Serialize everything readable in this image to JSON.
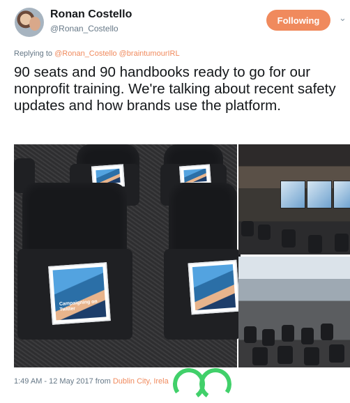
{
  "author": {
    "name": "Ronan Costello",
    "handle": "@Ronan_Costello"
  },
  "follow_button": {
    "label": "Following"
  },
  "menu_icon": "chevron-down-icon",
  "reply": {
    "prefix": "Replying to",
    "mentions": [
      "@Ronan_Costello",
      "@braintumourIRL"
    ]
  },
  "tweet": {
    "text": "90 seats and 90 handbooks ready to go for our nonprofit training. We're talking about recent safety updates and how brands use the platform."
  },
  "media": {
    "handbook_title": "Campaigning on Twitter"
  },
  "footer": {
    "timestamp": "1:49 AM - 12 May 2017 from",
    "location": "Dublin City, Irela"
  },
  "colors": {
    "accent": "#f08a5d",
    "secondary_text": "#657786"
  }
}
